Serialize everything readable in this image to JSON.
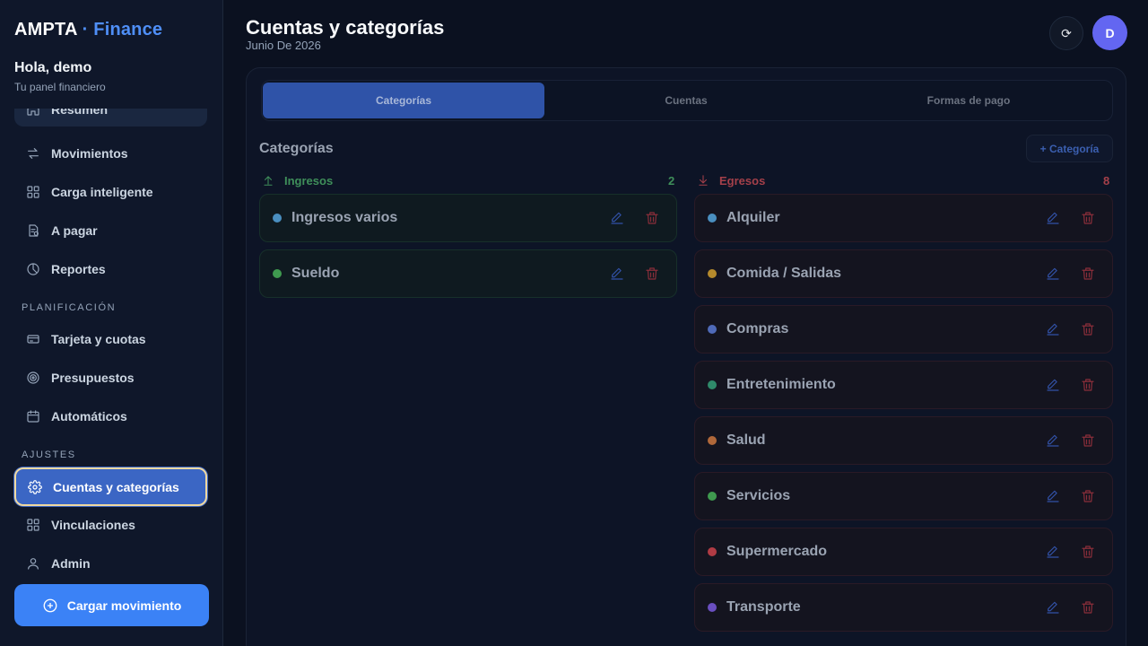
{
  "brand": {
    "name": "AMPTA",
    "accent": "· Finance"
  },
  "user": {
    "greeting": "Hola, demo",
    "subtitle": "Tu panel financiero",
    "avatar_initial": "D"
  },
  "nav": {
    "main": [
      {
        "label": "Resumen",
        "icon": "home-icon"
      },
      {
        "label": "Movimientos",
        "icon": "arrows-icon"
      },
      {
        "label": "Carga inteligente",
        "icon": "grid-icon"
      },
      {
        "label": "A pagar",
        "icon": "bill-icon"
      },
      {
        "label": "Reportes",
        "icon": "pie-icon"
      }
    ],
    "planning_label": "PLANIFICACIÓN",
    "planning": [
      {
        "label": "Tarjeta y cuotas",
        "icon": "card-icon"
      },
      {
        "label": "Presupuestos",
        "icon": "target-icon"
      },
      {
        "label": "Automáticos",
        "icon": "calendar-icon"
      }
    ],
    "settings_label": "AJUSTES",
    "settings": [
      {
        "label": "Cuentas y categorías",
        "icon": "gear-icon",
        "active": true
      },
      {
        "label": "Vinculaciones",
        "icon": "grid-icon"
      },
      {
        "label": "Admin",
        "icon": "user-icon"
      }
    ],
    "cta": "Cargar movimiento"
  },
  "header": {
    "title": "Cuentas y categorías",
    "subtitle": "Junio De 2026",
    "refresh_glyph": "⟳"
  },
  "tabs": [
    {
      "label": "Categorías",
      "active": true
    },
    {
      "label": "Cuentas",
      "active": false
    },
    {
      "label": "Formas de pago",
      "active": false
    }
  ],
  "categories": {
    "title": "Categorías",
    "add_label": "+ Categoría",
    "income": {
      "label": "Ingresos",
      "count": "2",
      "color": "#3f8f5a",
      "items": [
        {
          "name": "Ingresos varios",
          "color": "#4a8fc0"
        },
        {
          "name": "Sueldo",
          "color": "#3f9a4f"
        }
      ]
    },
    "expense": {
      "label": "Egresos",
      "count": "8",
      "color": "#a5404a",
      "items": [
        {
          "name": "Alquiler",
          "color": "#4a8fc0"
        },
        {
          "name": "Comida / Salidas",
          "color": "#b58a2c"
        },
        {
          "name": "Compras",
          "color": "#4f6ab8"
        },
        {
          "name": "Entretenimiento",
          "color": "#2f8a6a"
        },
        {
          "name": "Salud",
          "color": "#b0683a"
        },
        {
          "name": "Servicios",
          "color": "#3f9a4f"
        },
        {
          "name": "Supermercado",
          "color": "#b03b44"
        },
        {
          "name": "Transporte",
          "color": "#6a4fc0"
        }
      ]
    }
  }
}
